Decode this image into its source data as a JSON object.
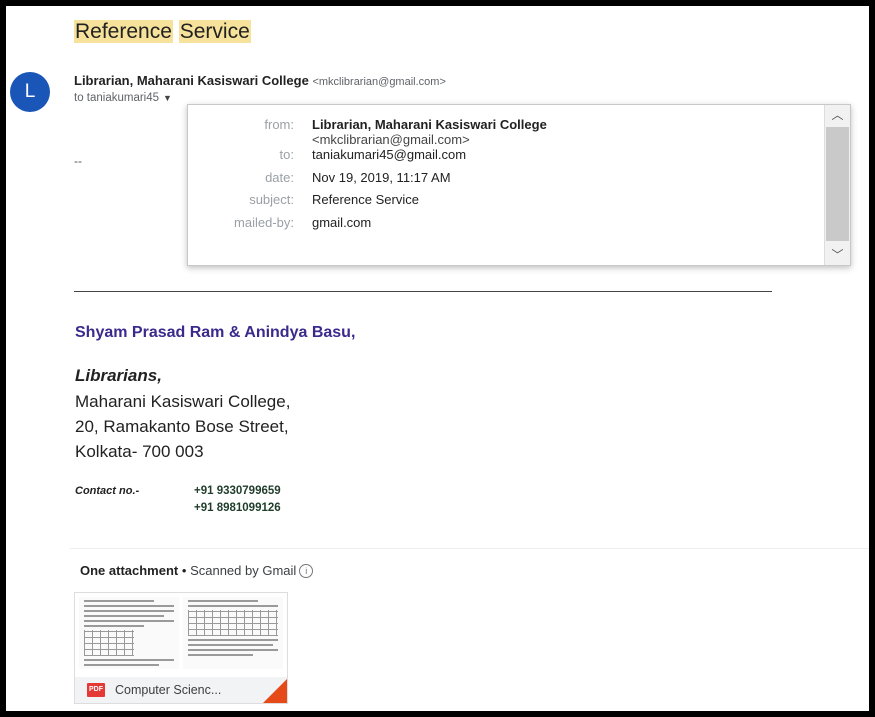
{
  "subject": {
    "word1": "Reference",
    "word2": "Service"
  },
  "sender": {
    "avatar_letter": "L",
    "name": "Librarian, Maharani Kasiswari College",
    "email": "<mkclibrarian@gmail.com>",
    "to_line": "to taniakumari45"
  },
  "details_popup": {
    "rows": [
      {
        "label": "from:",
        "value": "Librarian, Maharani Kasiswari College",
        "sub": "<mkclibrarian@gmail.com>"
      },
      {
        "label": "to:",
        "value": "taniakumari45@gmail.com"
      },
      {
        "label": "date:",
        "value": "Nov 19, 2019, 11:17 AM"
      },
      {
        "label": "subject:",
        "value": "Reference Service"
      },
      {
        "label": "mailed-by:",
        "value": "gmail.com"
      }
    ]
  },
  "body": {
    "dash": "--",
    "names": "Shyam Prasad Ram & Anindya Basu,",
    "role": "Librarians,",
    "address": [
      "Maharani Kasiswari College,",
      "20, Ramakanto Bose Street,",
      "Kolkata- 700 003"
    ],
    "contact_label": "Contact no.-",
    "phones": [
      "+91 9330799659",
      "+91 8981099126"
    ]
  },
  "attachments": {
    "header": "One attachment",
    "separator": "•",
    "scanned": "Scanned by Gmail",
    "file": {
      "badge": "PDF",
      "name": "Computer Scienc..."
    }
  },
  "colors": {
    "avatar": "#1a56b8",
    "highlight": "#f6e29a",
    "names": "#3b2a8c",
    "pdf": "#e53935"
  }
}
